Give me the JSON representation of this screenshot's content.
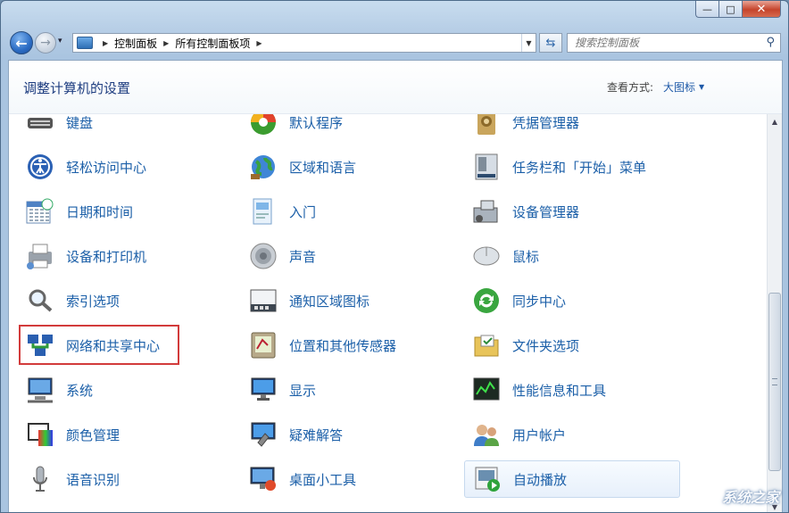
{
  "window": {
    "caption": {
      "minimize": "—",
      "maximize": "□",
      "close": "✕"
    }
  },
  "nav": {
    "back": "←",
    "forward": "→",
    "dropdown": "▾",
    "breadcrumbs": [
      "控制面板",
      "所有控制面板项"
    ],
    "search_placeholder": "搜索控制面板"
  },
  "header": {
    "title": "调整计算机的设置",
    "view_label": "查看方式:",
    "view_value": "大图标"
  },
  "items": [
    {
      "label": "键盘",
      "icon": "keyboard-icon",
      "col": 0,
      "row": 0
    },
    {
      "label": "默认程序",
      "icon": "default-programs-icon",
      "col": 1,
      "row": 0
    },
    {
      "label": "凭据管理器",
      "icon": "credential-vault-icon",
      "col": 2,
      "row": 0
    },
    {
      "label": "轻松访问中心",
      "icon": "ease-of-access-icon",
      "col": 0,
      "row": 1
    },
    {
      "label": "区域和语言",
      "icon": "globe-icon",
      "col": 1,
      "row": 1
    },
    {
      "label": "任务栏和「开始」菜单",
      "icon": "taskbar-icon",
      "col": 2,
      "row": 1
    },
    {
      "label": "日期和时间",
      "icon": "calendar-clock-icon",
      "col": 0,
      "row": 2
    },
    {
      "label": "入门",
      "icon": "getting-started-icon",
      "col": 1,
      "row": 2
    },
    {
      "label": "设备管理器",
      "icon": "device-manager-icon",
      "col": 2,
      "row": 2
    },
    {
      "label": "设备和打印机",
      "icon": "printer-icon",
      "col": 0,
      "row": 3
    },
    {
      "label": "声音",
      "icon": "speaker-icon",
      "col": 1,
      "row": 3
    },
    {
      "label": "鼠标",
      "icon": "mouse-icon",
      "col": 2,
      "row": 3
    },
    {
      "label": "索引选项",
      "icon": "magnifier-icon",
      "col": 0,
      "row": 4
    },
    {
      "label": "通知区域图标",
      "icon": "notification-area-icon",
      "col": 1,
      "row": 4
    },
    {
      "label": "同步中心",
      "icon": "sync-icon",
      "col": 2,
      "row": 4
    },
    {
      "label": "网络和共享中心",
      "icon": "network-icon",
      "col": 0,
      "row": 5
    },
    {
      "label": "位置和其他传感器",
      "icon": "location-sensor-icon",
      "col": 1,
      "row": 5
    },
    {
      "label": "文件夹选项",
      "icon": "folder-options-icon",
      "col": 2,
      "row": 5
    },
    {
      "label": "系统",
      "icon": "system-icon",
      "col": 0,
      "row": 6
    },
    {
      "label": "显示",
      "icon": "display-icon",
      "col": 1,
      "row": 6
    },
    {
      "label": "性能信息和工具",
      "icon": "performance-icon",
      "col": 2,
      "row": 6
    },
    {
      "label": "颜色管理",
      "icon": "color-management-icon",
      "col": 0,
      "row": 7
    },
    {
      "label": "疑难解答",
      "icon": "troubleshooting-icon",
      "col": 1,
      "row": 7
    },
    {
      "label": "用户帐户",
      "icon": "user-accounts-icon",
      "col": 2,
      "row": 7
    },
    {
      "label": "语音识别",
      "icon": "microphone-icon",
      "col": 0,
      "row": 8
    },
    {
      "label": "桌面小工具",
      "icon": "gadgets-icon",
      "col": 1,
      "row": 8
    },
    {
      "label": "自动播放",
      "icon": "autoplay-icon",
      "col": 2,
      "row": 8,
      "hover": true
    }
  ],
  "highlighted_item": "网络和共享中心",
  "watermark": "系统之家",
  "colors": {
    "link": "#1b5fa8",
    "title": "#1e3d80",
    "highlight_box": "#d23b3b"
  }
}
